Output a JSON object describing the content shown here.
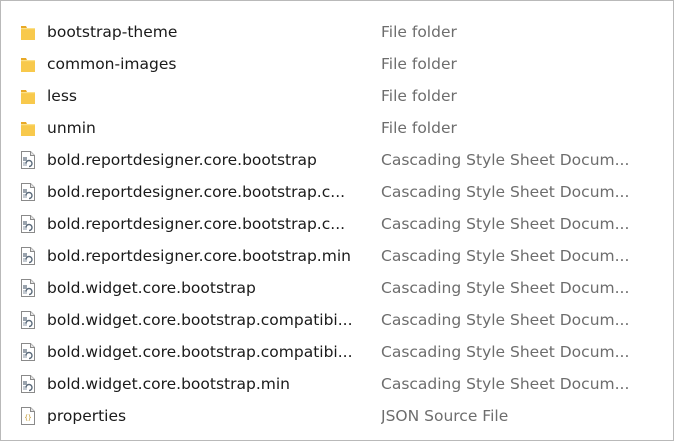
{
  "files": [
    {
      "name": "bootstrap-theme",
      "type": "File folder",
      "icon": "folder-icon"
    },
    {
      "name": "common-images",
      "type": "File folder",
      "icon": "folder-icon"
    },
    {
      "name": "less",
      "type": "File folder",
      "icon": "folder-icon"
    },
    {
      "name": "unmin",
      "type": "File folder",
      "icon": "folder-icon"
    },
    {
      "name": "bold.reportdesigner.core.bootstrap",
      "type": "Cascading Style Sheet Docum...",
      "icon": "css-file-icon"
    },
    {
      "name": "bold.reportdesigner.core.bootstrap.c...",
      "type": "Cascading Style Sheet Docum...",
      "icon": "css-file-icon"
    },
    {
      "name": "bold.reportdesigner.core.bootstrap.c...",
      "type": "Cascading Style Sheet Docum...",
      "icon": "css-file-icon"
    },
    {
      "name": "bold.reportdesigner.core.bootstrap.min",
      "type": "Cascading Style Sheet Docum...",
      "icon": "css-file-icon"
    },
    {
      "name": "bold.widget.core.bootstrap",
      "type": "Cascading Style Sheet Docum...",
      "icon": "css-file-icon"
    },
    {
      "name": "bold.widget.core.bootstrap.compatibi...",
      "type": "Cascading Style Sheet Docum...",
      "icon": "css-file-icon"
    },
    {
      "name": "bold.widget.core.bootstrap.compatibi...",
      "type": "Cascading Style Sheet Docum...",
      "icon": "css-file-icon"
    },
    {
      "name": "bold.widget.core.bootstrap.min",
      "type": "Cascading Style Sheet Docum...",
      "icon": "css-file-icon"
    },
    {
      "name": "properties",
      "type": "JSON Source File",
      "icon": "json-file-icon"
    }
  ],
  "colors": {
    "folder": "#f5c342",
    "name_text": "#1a1a1a",
    "type_text": "#6d6d6d"
  }
}
